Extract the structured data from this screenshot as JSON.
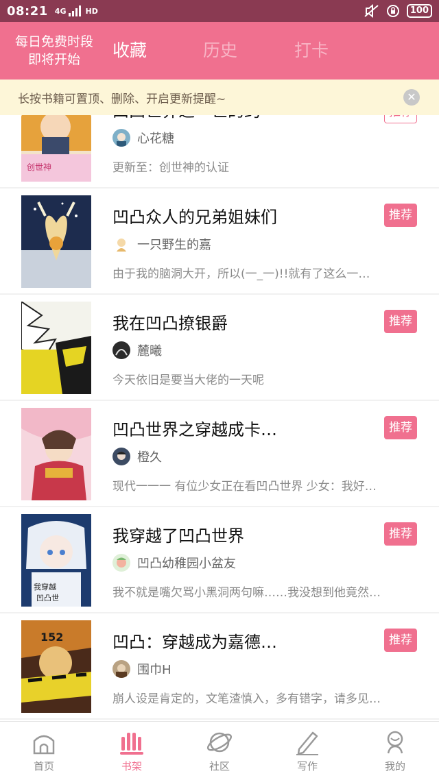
{
  "status_bar": {
    "time": "08:21",
    "network": "4G",
    "hd": "HD",
    "battery": "100"
  },
  "header": {
    "promo_line1": "每日免费时段",
    "promo_line2": "即将开始",
    "tabs": [
      {
        "label": "收藏",
        "active": true
      },
      {
        "label": "历史",
        "active": false
      },
      {
        "label": "打卡",
        "active": false
      }
    ]
  },
  "notice": {
    "text": "长按书籍可置顶、删除、开启更新提醒~"
  },
  "books": [
    {
      "title": "凹凸世界之一世的约",
      "author": "心花糖",
      "desc": "更新至：创世神的认证",
      "tag": "推荐"
    },
    {
      "title": "凹凸众人的兄弟姐妹们",
      "author": "一只野生的嘉",
      "desc": "由于我的脑洞大开，所以(一_一)!!就有了这么一…",
      "tag": "推荐"
    },
    {
      "title": "我在凹凸撩银爵",
      "author": "麓曦",
      "desc": "今天依旧是要当大佬的一天呢",
      "tag": "推荐"
    },
    {
      "title": "凹凸世界之穿越成卡…",
      "author": "橙久",
      "desc": "现代一一一 有位少女正在看凹凸世界 少女：我好…",
      "tag": "推荐"
    },
    {
      "title": "我穿越了凹凸世界",
      "author": "凹凸幼稚园小盆友",
      "desc": "我不就是嘴欠骂小黑洞两句嘛……我没想到他竟然…",
      "tag": "推荐"
    },
    {
      "title": "凹凸：穿越成为嘉德…",
      "author": "围巾H",
      "desc": "崩人设是肯定的，文笔渣慎入，多有错字，请多见…",
      "tag": "推荐"
    }
  ],
  "bottom_nav": [
    {
      "label": "首页",
      "icon": "home-icon",
      "active": false
    },
    {
      "label": "书架",
      "icon": "bookshelf-icon",
      "active": true
    },
    {
      "label": "社区",
      "icon": "planet-icon",
      "active": false
    },
    {
      "label": "写作",
      "icon": "pen-icon",
      "active": false
    },
    {
      "label": "我的",
      "icon": "profile-icon",
      "active": false
    }
  ],
  "colors": {
    "accent": "#f0708f",
    "status_bar": "#8a3a52",
    "notice_bg": "#fdf6d8"
  }
}
